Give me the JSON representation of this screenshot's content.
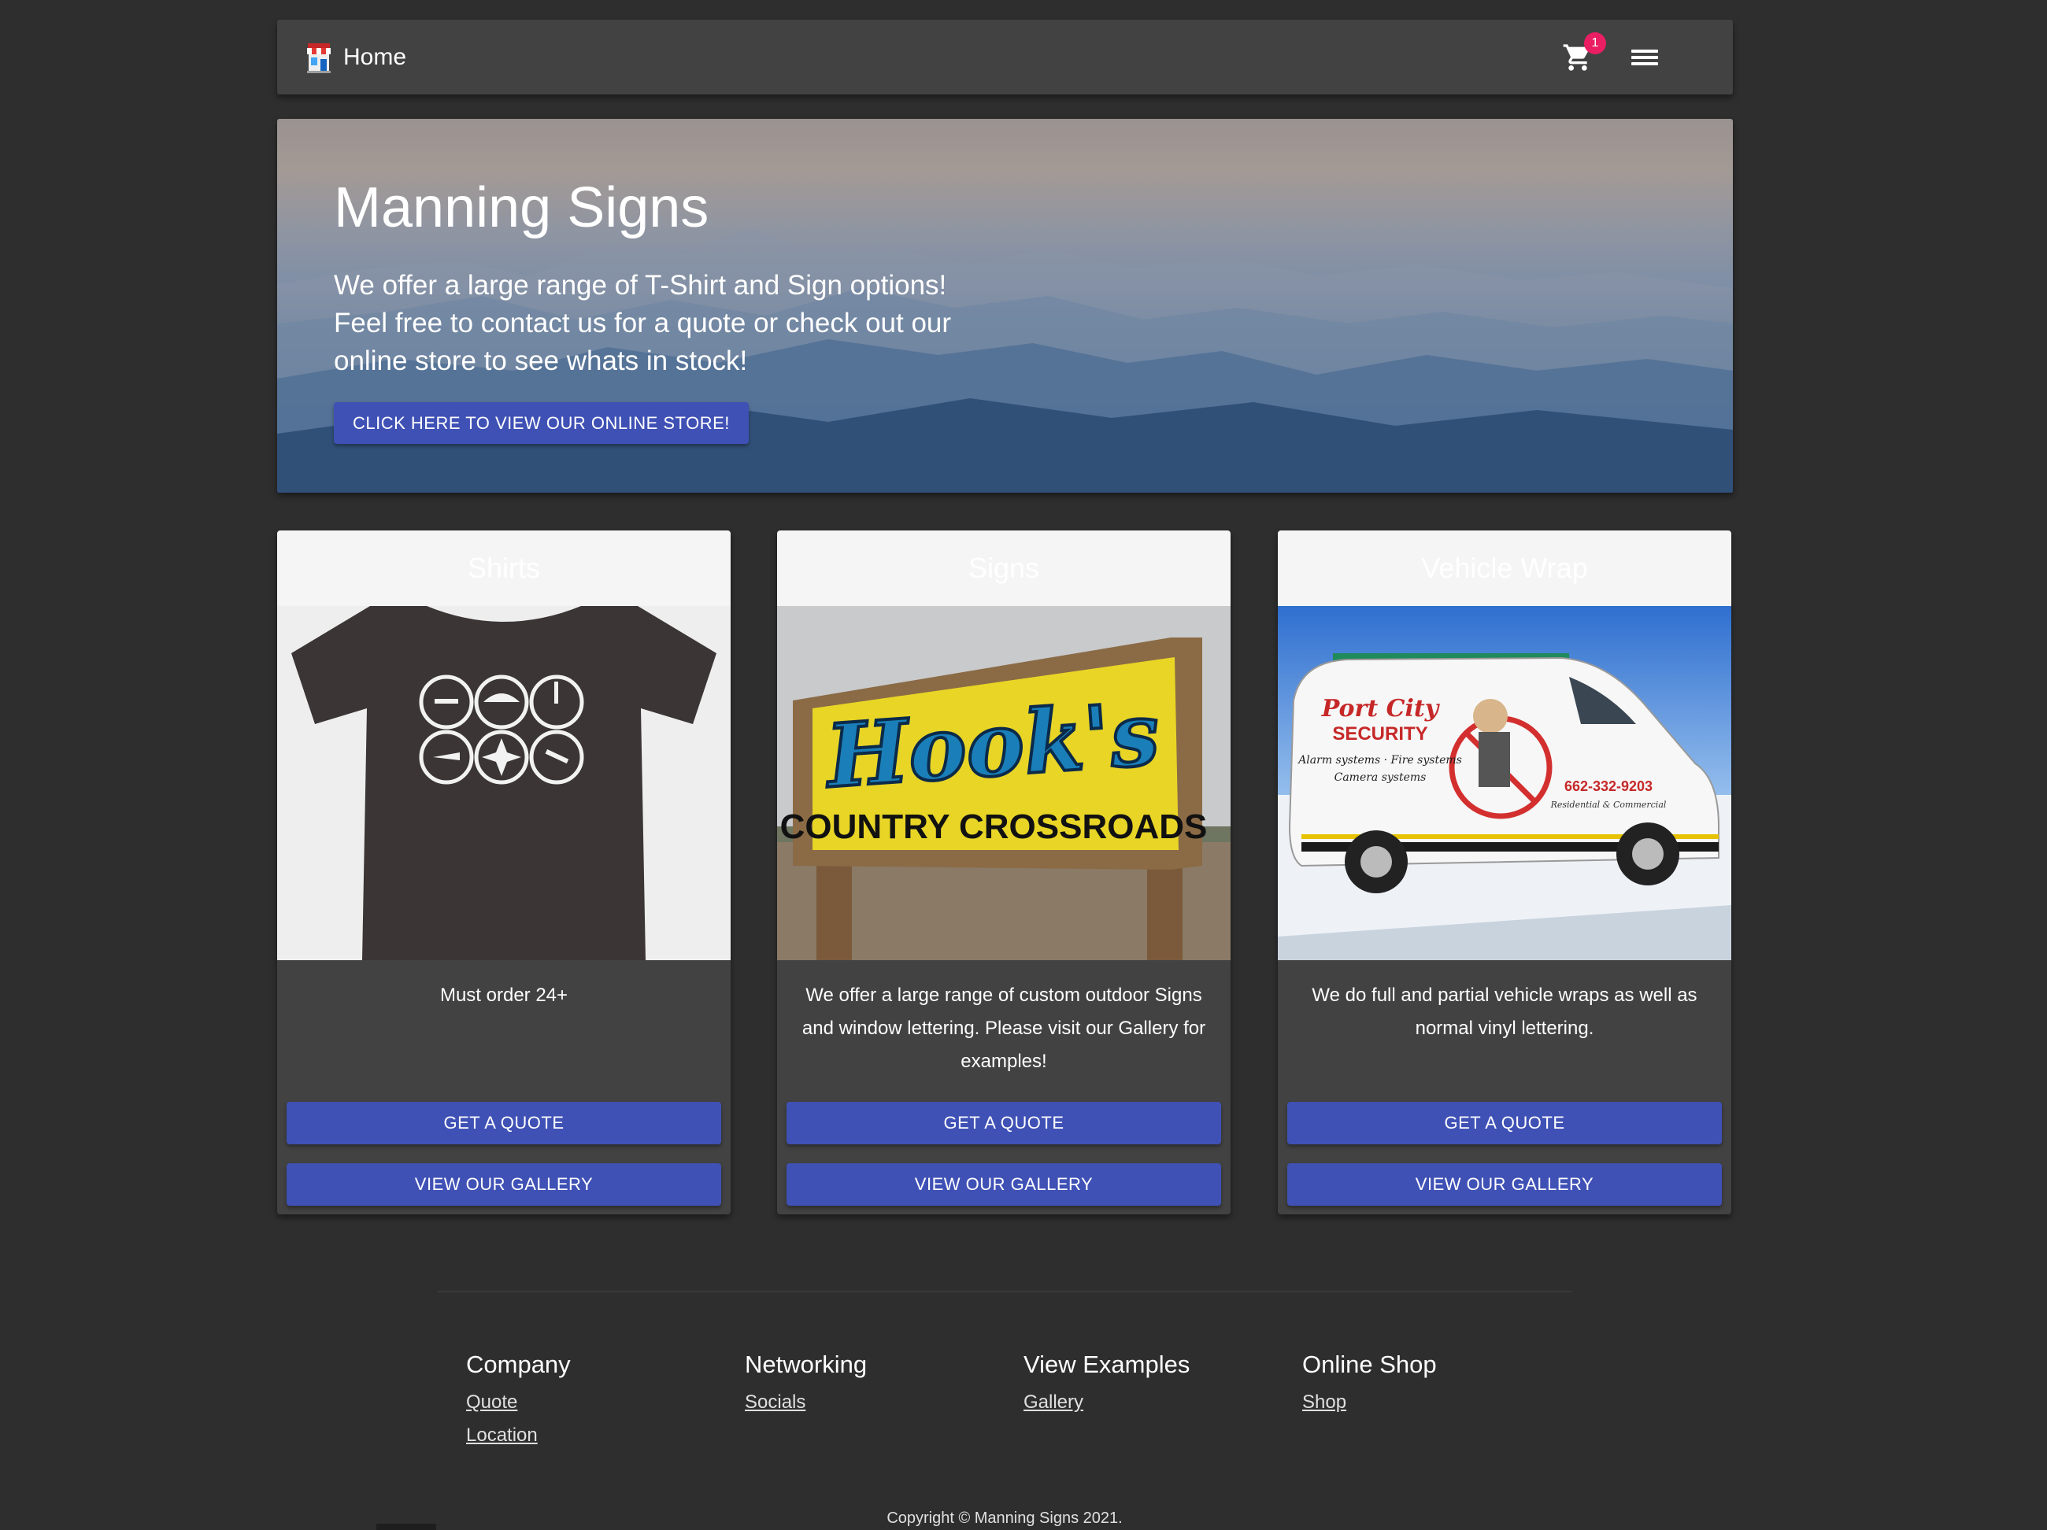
{
  "navbar": {
    "brand_label": "Home",
    "brand_icon": "storefront-icon",
    "cart_icon": "cart-icon",
    "cart_count": "1",
    "menu_icon": "hamburger-menu-icon"
  },
  "hero": {
    "title": "Manning Signs",
    "text": "We offer a large range of T-Shirt and Sign options! Feel free to contact us for a quote or check out our online store to see whats in stock!",
    "button_label": "CLICK HERE TO VIEW OUR ONLINE STORE!"
  },
  "cards": [
    {
      "title": "Shirts",
      "text": "Must order 24+",
      "image_caption": "",
      "quote_label": "GET A QUOTE",
      "gallery_label": "VIEW OUR GALLERY"
    },
    {
      "title": "Signs",
      "text": "We offer a large range of custom outdoor Signs and window lettering. Please visit our Gallery for examples!",
      "sign_title": "Hook's",
      "sign_subtitle": "COUNTRY CROSSROADS",
      "quote_label": "GET A QUOTE",
      "gallery_label": "VIEW OUR GALLERY"
    },
    {
      "title": "Vehicle Wrap",
      "text": "We do full and partial vehicle wraps as well as normal vinyl lettering.",
      "van_brand_1": "Port City",
      "van_brand_2": "SECURITY",
      "van_services_1": "Alarm systems · Fire systems",
      "van_services_2": "Camera systems",
      "van_phone": "662-332-9203",
      "van_tagline": "Residential & Commercial",
      "quote_label": "GET A QUOTE",
      "gallery_label": "VIEW OUR GALLERY"
    }
  ],
  "footer": {
    "columns": [
      {
        "heading": "Company",
        "links": [
          "Quote",
          "Location"
        ]
      },
      {
        "heading": "Networking",
        "links": [
          "Socials"
        ]
      },
      {
        "heading": "View Examples",
        "links": [
          "Gallery"
        ]
      },
      {
        "heading": "Online Shop",
        "links": [
          "Shop"
        ]
      }
    ],
    "copyright": "Copyright © Manning Signs 2021."
  },
  "colors": {
    "background": "#2e2e2e",
    "surface": "#424242",
    "primary": "#3f51b5",
    "badge": "#e91e63"
  }
}
